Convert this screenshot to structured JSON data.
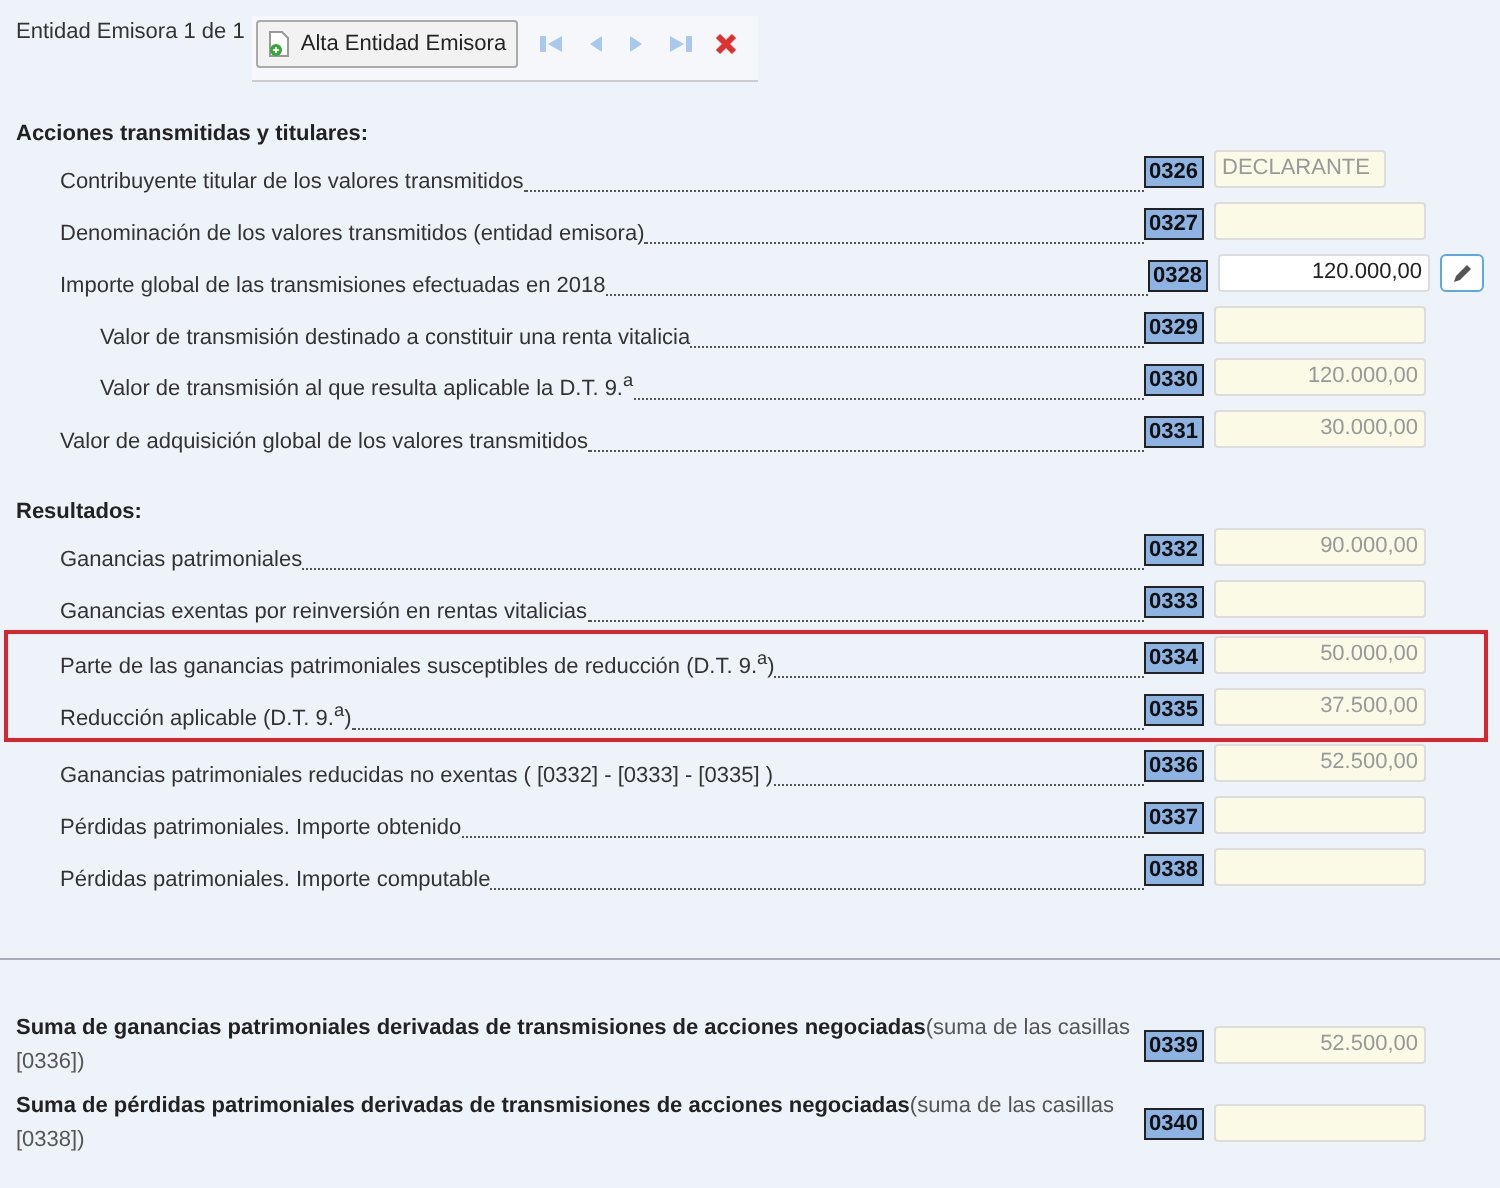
{
  "header": {
    "counter": "Entidad Emisora 1 de 1",
    "add_button": "Alta Entidad Emisora"
  },
  "sections": [
    {
      "title": "Acciones transmitidas y titulares:",
      "rows": [
        {
          "kind": "row",
          "label": "Contribuyente titular de los valores transmitidos",
          "code": "0326",
          "field": {
            "kind": "text",
            "value": "DECLARANTE",
            "editable": false
          }
        },
        {
          "kind": "row",
          "label": "Denominación de los valores transmitidos (entidad emisora)",
          "code": "0327",
          "field": {
            "kind": "amount",
            "editable": false
          }
        },
        {
          "kind": "row",
          "label": "Importe global de las transmisiones efectuadas en 2018",
          "code": "0328",
          "field": {
            "kind": "amount",
            "value": "120.000,00",
            "editable": true
          },
          "children": [
            {
              "kind": "row",
              "label": "Valor de transmisión destinado a constituir una renta vitalicia",
              "code": "0329",
              "field": {
                "kind": "amount",
                "editable": false
              }
            },
            {
              "kind": "row",
              "label": "Valor de transmisión al que resulta aplicable la D.T. 9.$^{a}$",
              "code": "0330",
              "field": {
                "kind": "amount",
                "value": "120.000,00",
                "editable": false
              }
            }
          ]
        },
        {
          "kind": "row",
          "label": "Valor de adquisición global de los valores transmitidos",
          "code": "0331",
          "field": {
            "kind": "amount",
            "value": "30.000,00",
            "editable": false
          }
        }
      ]
    },
    {
      "title": "Resultados:",
      "rows": [
        {
          "kind": "row",
          "label": "Ganancias patrimoniales",
          "code": "0332",
          "field": {
            "kind": "amount",
            "value": "90.000,00",
            "editable": false
          }
        },
        {
          "kind": "row",
          "label": "Ganancias exentas por reinversión en rentas vitalicias",
          "code": "0333",
          "field": {
            "kind": "amount",
            "editable": false
          }
        },
        {
          "kind": "highlight",
          "rows": [
            {
              "kind": "row",
              "label": "Parte de las ganancias patrimoniales susceptibles de reducción (D.T. 9.$^{a}$)",
              "code": "0334",
              "field": {
                "kind": "amount",
                "value": "50.000,00",
                "editable": false
              }
            },
            {
              "kind": "row",
              "label": "Reducción aplicable (D.T. 9.$^{a}$)",
              "code": "0335",
              "field": {
                "kind": "amount",
                "value": "37.500,00",
                "editable": false
              }
            }
          ]
        },
        {
          "kind": "row",
          "label": "Ganancias patrimoniales reducidas no exentas ( [0332] - [0333] - [0335] )",
          "code": "0336",
          "field": {
            "kind": "amount",
            "value": "52.500,00",
            "editable": false
          }
        },
        {
          "kind": "row",
          "label": "Pérdidas patrimoniales. Importe obtenido",
          "code": "0337",
          "field": {
            "kind": "amount",
            "editable": false
          }
        },
        {
          "kind": "row",
          "label": "Pérdidas patrimoniales. Importe computable",
          "code": "0338",
          "field": {
            "kind": "amount",
            "editable": false
          }
        }
      ]
    }
  ],
  "totals": [
    {
      "label": "**Suma de ganancias patrimoniales derivadas de transmisiones de acciones negociadas**(suma de las casillas [0336])",
      "code": "0339",
      "field": {
        "kind": "amount",
        "value": "52.500,00",
        "editable": false
      }
    },
    {
      "label": "**Suma de pérdidas patrimoniales derivadas de transmisiones de acciones negociadas**(suma de las casillas [0338])",
      "code": "0340",
      "field": {
        "kind": "amount",
        "editable": false
      }
    }
  ]
}
